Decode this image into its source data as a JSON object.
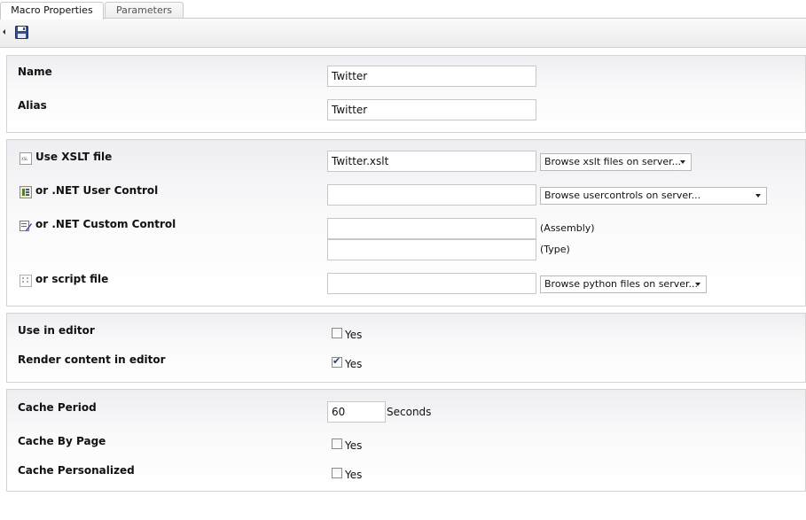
{
  "tabs": [
    {
      "label": "Macro Properties",
      "active": true
    },
    {
      "label": "Parameters",
      "active": false
    }
  ],
  "toolbar": {
    "icons": [
      "collapse-arrow-icon",
      "save-icon"
    ]
  },
  "general": {
    "name_label": "Name",
    "name_value": "Twitter",
    "alias_label": "Alias",
    "alias_value": "Twitter"
  },
  "render": {
    "xslt_label": "Use XSLT file",
    "xslt_value": "Twitter.xslt",
    "xslt_browse": "Browse xslt files on server...",
    "usercontrol_label": "or .NET User Control",
    "usercontrol_value": "",
    "usercontrol_browse": "Browse usercontrols on server...",
    "customcontrol_label": "or .NET Custom Control",
    "assembly_value": "",
    "assembly_label": "(Assembly)",
    "type_value": "",
    "type_label": "(Type)",
    "script_label": "or script file",
    "script_value": "",
    "script_browse": "Browse python files on server..."
  },
  "editor": {
    "use_in_editor_label": "Use in editor",
    "use_in_editor_checked": false,
    "render_content_label": "Render content in editor",
    "render_content_checked": true,
    "yes_label": "Yes"
  },
  "cache": {
    "period_label": "Cache Period",
    "period_value": "60",
    "period_unit": "Seconds",
    "by_page_label": "Cache By Page",
    "by_page_checked": false,
    "personalized_label": "Cache Personalized",
    "personalized_checked": false,
    "yes_label": "Yes"
  },
  "colors": {
    "panel_border": "#d4d4d4",
    "checkmark": "#2a3f78",
    "save_icon": "#2f4f9a"
  }
}
